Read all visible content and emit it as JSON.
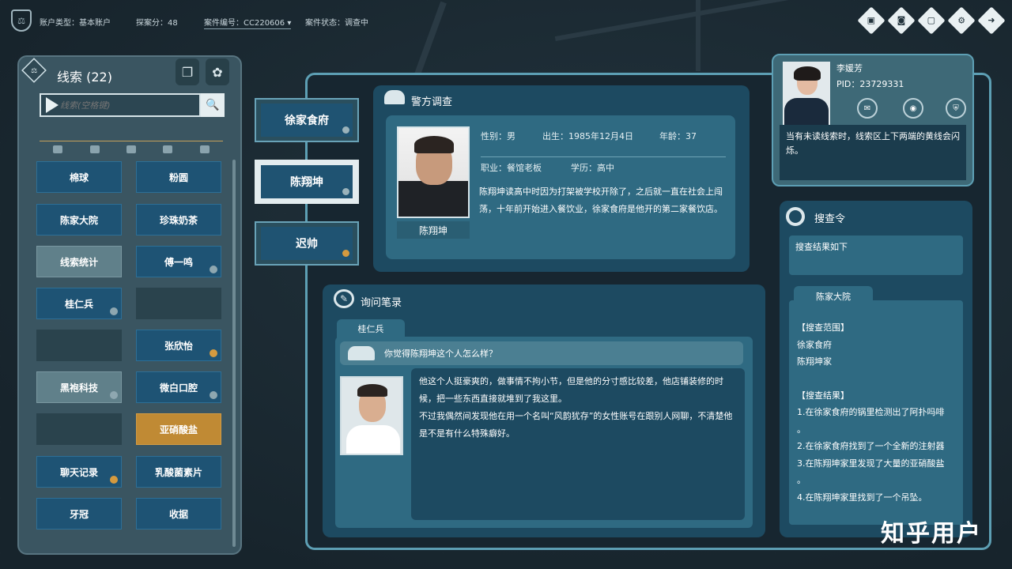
{
  "topbar": {
    "account_type_label": "账户类型：",
    "account_type_value": "基本账户",
    "score_label": "探案分：",
    "score_value": "48",
    "case_no_label": "案件编号：",
    "case_no_value": "CC220606",
    "case_status_label": "案件状态：",
    "case_status_value": "调查中",
    "icons": [
      "video-icon",
      "camera-icon",
      "screen-icon",
      "gear-icon",
      "exit-icon"
    ]
  },
  "clue_panel": {
    "title": "线索",
    "count": "(22)",
    "search_placeholder": "线索(空格键)",
    "clues": [
      {
        "label": "棉球",
        "style": "blue"
      },
      {
        "label": "粉圆",
        "style": "blue"
      },
      {
        "label": "陈家大院",
        "style": "blue"
      },
      {
        "label": "珍珠奶茶",
        "style": "blue"
      },
      {
        "label": "线索统计",
        "style": "gray"
      },
      {
        "label": "傅一鸣",
        "style": "blue"
      },
      {
        "label": "桂仁兵",
        "style": "blue"
      },
      {
        "label": "",
        "style": "dark"
      },
      {
        "label": "",
        "style": "dark"
      },
      {
        "label": "张欣怡",
        "style": "blue"
      },
      {
        "label": "黑袍科技",
        "style": "gray"
      },
      {
        "label": "微白口腔",
        "style": "blue"
      },
      {
        "label": "",
        "style": "dark"
      },
      {
        "label": "亚硝酸盐",
        "style": "gold"
      },
      {
        "label": "聊天记录",
        "style": "blue"
      },
      {
        "label": "乳酸菌素片",
        "style": "blue"
      },
      {
        "label": "牙冠",
        "style": "blue"
      },
      {
        "label": "收据",
        "style": "blue"
      }
    ]
  },
  "suspects": [
    {
      "name": "徐家食府"
    },
    {
      "name": "陈翔坤"
    },
    {
      "name": "迟帅"
    }
  ],
  "police_card": {
    "title": "警方调查",
    "name": "陈翔坤",
    "gender": "性别：男",
    "birth": "出生：1985年12月4日",
    "age": "年龄：37",
    "job": "职业：餐馆老板",
    "edu": "学历：高中",
    "bio": "陈翔坤读高中时因为打架被学校开除了，之后就一直在社会上闯荡，十年前开始进入餐饮业，徐家食府是他开的第二家餐饮店。"
  },
  "interrogation": {
    "title": "询问笔录",
    "tab": "桂仁兵",
    "question": "你觉得陈翔坤这个人怎么样？",
    "answer_1": "他这个人挺豪爽的，做事情不拘小节，但是他的分寸感比较差，他店铺装修的时候，把一些东西直接就堆到了我这里。",
    "answer_2": "不过我偶然间发现他在用一个名叫“风韵犹存”的女性账号在跟别人网聊，不清楚他是不是有什么特殊癖好。"
  },
  "profile": {
    "name": "李媛芳",
    "pid": "PID：23729331",
    "message": "当有未读线索时，线索区上下两端的黄线会闪烁。"
  },
  "search_order": {
    "title": "搜查令",
    "result_header": "搜查结果如下",
    "tab": "陈家大院",
    "scope_title": "【搜查范围】",
    "scope": [
      "徐家食府",
      "陈翔坤家"
    ],
    "result_title": "【搜查结果】",
    "results": [
      "1.在徐家食府的锅里检测出了阿扑吗啡",
      "。",
      "2.在徐家食府找到了一个全新的注射器",
      "3.在陈翔坤家里发现了大量的亚硝酸盐",
      "。",
      "4.在陈翔坤家里找到了一个吊坠。"
    ]
  },
  "watermark": "知乎用户"
}
